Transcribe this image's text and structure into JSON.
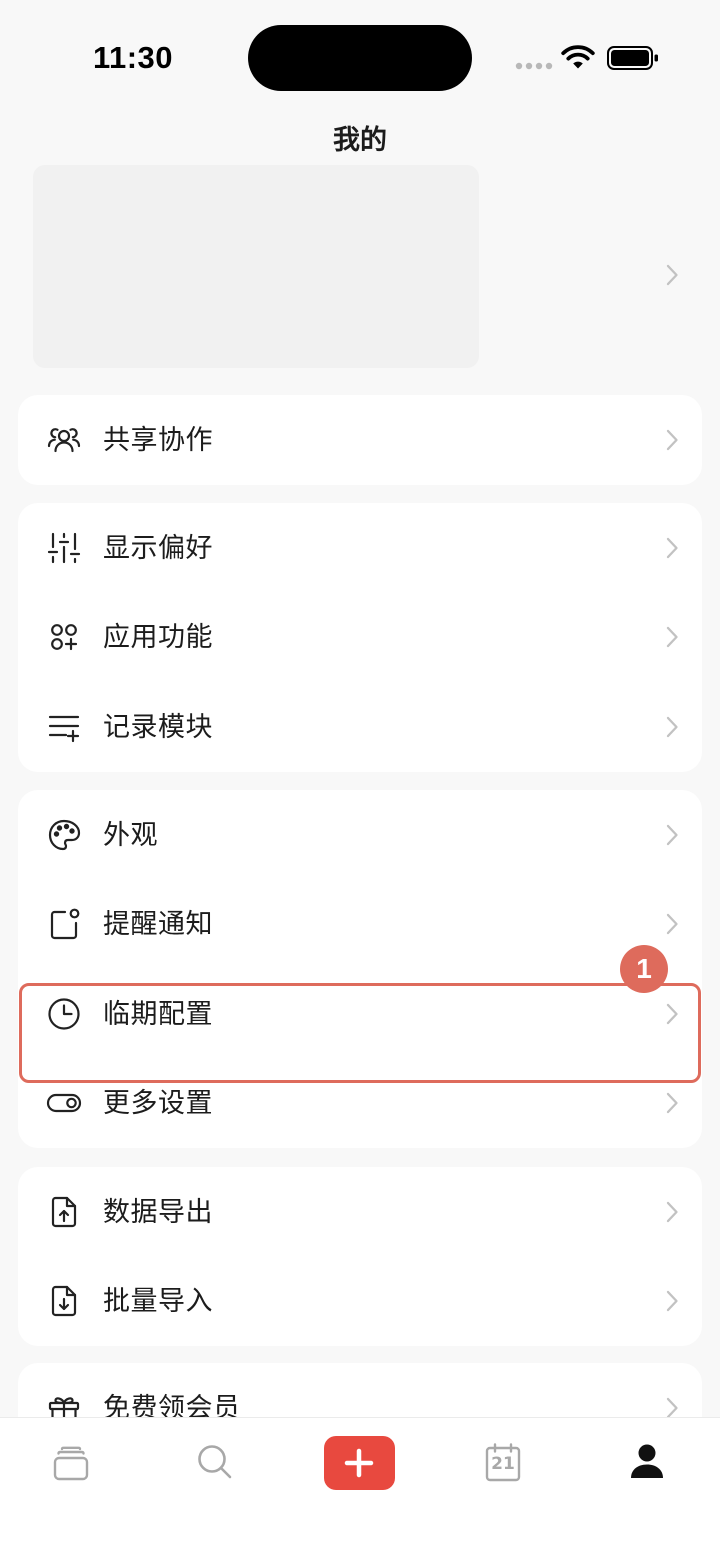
{
  "status_bar": {
    "time": "11:30"
  },
  "header": {
    "title": "我的"
  },
  "groups": [
    {
      "items": [
        {
          "label": "共享协作",
          "icon": "people-icon"
        }
      ]
    },
    {
      "items": [
        {
          "label": "显示偏好",
          "icon": "sliders-icon"
        },
        {
          "label": "应用功能",
          "icon": "apps-icon"
        },
        {
          "label": "记录模块",
          "icon": "list-add-icon"
        }
      ]
    },
    {
      "items": [
        {
          "label": "外观",
          "icon": "palette-icon"
        },
        {
          "label": "提醒通知",
          "icon": "notification-icon"
        },
        {
          "label": "临期配置",
          "icon": "clock-icon"
        },
        {
          "label": "更多设置",
          "icon": "toggle-icon"
        }
      ]
    },
    {
      "items": [
        {
          "label": "数据导出",
          "icon": "file-upload-icon"
        },
        {
          "label": "批量导入",
          "icon": "file-download-icon"
        }
      ]
    },
    {
      "items": [
        {
          "label": "免费领会员",
          "icon": "gift-icon"
        }
      ]
    }
  ],
  "annotation": {
    "badge": "1"
  },
  "tab_bar": {
    "items": [
      {
        "icon": "stack-icon",
        "selected": false
      },
      {
        "icon": "search-icon",
        "selected": false
      },
      {
        "icon": "plus-icon",
        "selected": false
      },
      {
        "icon": "calendar-icon",
        "selected": false,
        "day": "21"
      },
      {
        "icon": "profile-icon",
        "selected": true
      }
    ]
  },
  "colors": {
    "background": "#f8f8f8",
    "card": "#ffffff",
    "text": "#1c1c1c",
    "chevron": "#c2c2c2",
    "accent": "#e8493f",
    "annotation": "#de6b5c",
    "tab_inactive": "#a8a8a8",
    "tab_active": "#111111"
  }
}
